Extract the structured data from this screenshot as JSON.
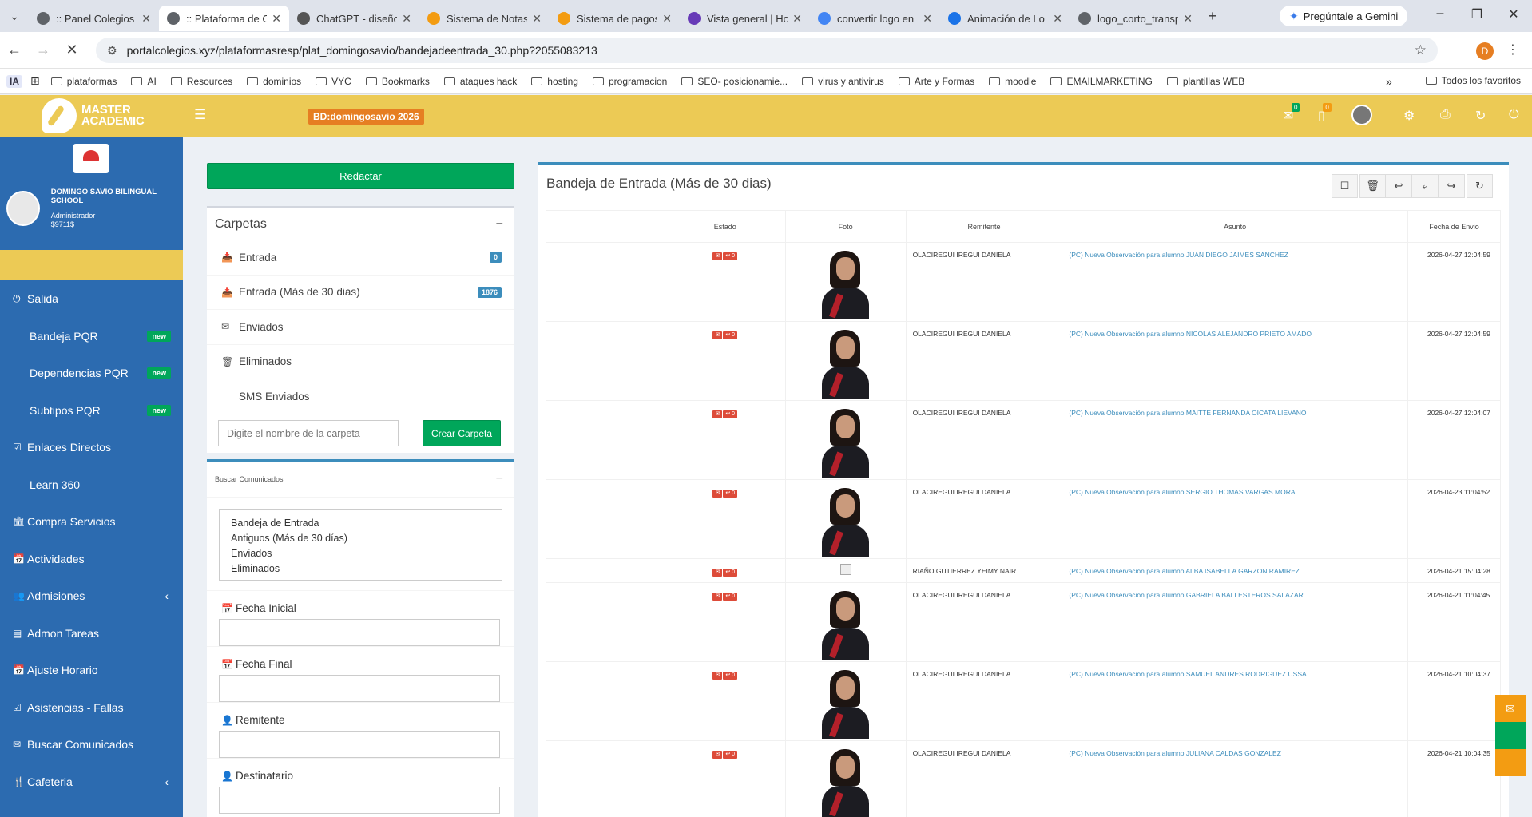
{
  "browser": {
    "tabs": [
      {
        "title": ":: Panel Colegios",
        "color": "#5f6368",
        "active": false
      },
      {
        "title": ":: Plataforma de C",
        "color": "#5f6368",
        "active": true
      },
      {
        "title": "ChatGPT - diseño",
        "color": "#555555",
        "active": false
      },
      {
        "title": "Sistema de Notas",
        "color": "#f39c12",
        "active": false
      },
      {
        "title": "Sistema de pagos",
        "color": "#f39c12",
        "active": false
      },
      {
        "title": "Vista general | Ho",
        "color": "#673ab7",
        "active": false
      },
      {
        "title": "convertir logo en",
        "color": "#4285f4",
        "active": false
      },
      {
        "title": "Animación de Lo",
        "color": "#1a73e8",
        "active": false
      },
      {
        "title": "logo_corto_transp",
        "color": "#5f6368",
        "active": false
      }
    ],
    "gemini_label": "Pregúntale a Gemini",
    "url": "portalcolegios.xyz/plataformasresp/plat_domingosavio/bandejadeentrada_30.php?2055083213",
    "profile_initial": "D",
    "bookmarks": [
      "plataformas",
      "AI",
      "Resources",
      "dominios",
      "VYC",
      "Bookmarks",
      "ataques hack",
      "hosting",
      "programacion",
      "SEO- posicionamie...",
      "virus y antivirus",
      "Arte y Formas",
      "moodle",
      "EMAILMARKETING",
      "plantillas WEB"
    ],
    "bookmarks_ia": "IA",
    "bookmarks_all": "Todos los favoritos"
  },
  "header": {
    "logo_line1": "MASTER",
    "logo_line2": "ACADEMIC",
    "db_badge": "BD:domingosavio 2026",
    "mail_count": "0",
    "doc_count": "0"
  },
  "sidebar": {
    "school_name": "DOMINGO SAVIO BILINGUAL SCHOOL",
    "role": "Administrador",
    "user_code": "$9711$",
    "items": [
      {
        "label": "Salida",
        "icon": "⏻",
        "sub": false,
        "new": false,
        "arrow": false
      },
      {
        "label": "Bandeja PQR",
        "icon": "",
        "sub": true,
        "new": true,
        "arrow": false
      },
      {
        "label": "Dependencias PQR",
        "icon": "",
        "sub": true,
        "new": true,
        "arrow": false
      },
      {
        "label": "Subtipos PQR",
        "icon": "",
        "sub": true,
        "new": true,
        "arrow": false
      },
      {
        "label": "Enlaces Directos",
        "icon": "☑",
        "sub": false,
        "new": false,
        "arrow": false
      },
      {
        "label": "Learn 360",
        "icon": "",
        "sub": true,
        "new": false,
        "arrow": false
      },
      {
        "label": "Compra Servicios",
        "icon": "🏛",
        "sub": false,
        "new": false,
        "arrow": false
      },
      {
        "label": "Actividades",
        "icon": "📅",
        "sub": false,
        "new": false,
        "arrow": false
      },
      {
        "label": "Admisiones",
        "icon": "👥",
        "sub": false,
        "new": false,
        "arrow": true
      },
      {
        "label": "Admon Tareas",
        "icon": "▤",
        "sub": false,
        "new": false,
        "arrow": false
      },
      {
        "label": "Ajuste Horario",
        "icon": "📅",
        "sub": false,
        "new": false,
        "arrow": false
      },
      {
        "label": "Asistencias - Fallas",
        "icon": "☑",
        "sub": false,
        "new": false,
        "arrow": false
      },
      {
        "label": "Buscar Comunicados",
        "icon": "✉",
        "sub": false,
        "new": false,
        "arrow": false
      },
      {
        "label": "Cafeteria",
        "icon": "🍴",
        "sub": false,
        "new": false,
        "arrow": true
      }
    ],
    "new_label": "new"
  },
  "left": {
    "compose_label": "Redactar",
    "folders_title": "Carpetas",
    "folders": [
      {
        "label": "Entrada",
        "icon": "📥",
        "count": "0"
      },
      {
        "label": "Entrada (Más de 30 dias)",
        "icon": "📥",
        "count": "1876"
      },
      {
        "label": "Enviados",
        "icon": "✉",
        "count": ""
      },
      {
        "label": "Eliminados",
        "icon": "🗑",
        "count": ""
      },
      {
        "label": "SMS Enviados",
        "icon": "",
        "count": ""
      }
    ],
    "folder_placeholder": "Digite el nombre de la carpeta",
    "create_folder_label": "Crear Carpeta",
    "search_title": "Buscar Comunicados",
    "search_options": [
      "Bandeja de Entrada",
      "Antiguos (Más de 30 días)",
      "Enviados",
      "Eliminados"
    ],
    "fields": [
      {
        "label": "Fecha Inicial",
        "icon": "📅"
      },
      {
        "label": "Fecha Final",
        "icon": "📅"
      },
      {
        "label": "Remitente",
        "icon": "👤"
      },
      {
        "label": "Destinatario",
        "icon": "👤"
      }
    ]
  },
  "inbox": {
    "title": "Bandeja de Entrada (Más de 30 dias)",
    "columns": [
      "",
      "Estado",
      "Foto",
      "Remitente",
      "Asunto",
      "Fecha de Envio"
    ],
    "rows": [
      {
        "sender": "OLACIREGUI IREGUI DANIELA",
        "subject": "(PC) Nueva Observación para alumno JUAN DIEGO JAIMES SANCHEZ",
        "date": "2026-04-27 12:04:59",
        "photo": true
      },
      {
        "sender": "OLACIREGUI IREGUI DANIELA",
        "subject": "(PC) Nueva Observación para alumno NICOLAS ALEJANDRO PRIETO AMADO",
        "date": "2026-04-27 12:04:59",
        "photo": true
      },
      {
        "sender": "OLACIREGUI IREGUI DANIELA",
        "subject": "(PC) Nueva Observación para alumno MAITTE FERNANDA OICATA LIEVANO",
        "date": "2026-04-27 12:04:07",
        "photo": true
      },
      {
        "sender": "OLACIREGUI IREGUI DANIELA",
        "subject": "(PC) Nueva Observación para alumno SERGIO THOMAS VARGAS MORA",
        "date": "2026-04-23 11:04:52",
        "photo": true
      },
      {
        "sender": "RIAÑO GUTIERREZ YEIMY NAIR",
        "subject": "(PC) Nueva Observación para alumno ALBA ISABELLA GARZON RAMIREZ",
        "date": "2026-04-21 15:04:28",
        "photo": false
      },
      {
        "sender": "OLACIREGUI IREGUI DANIELA",
        "subject": "(PC) Nueva Observación para alumno GABRIELA BALLESTEROS SALAZAR",
        "date": "2026-04-21 11:04:45",
        "photo": true
      },
      {
        "sender": "OLACIREGUI IREGUI DANIELA",
        "subject": "(PC) Nueva Observación para alumno SAMUEL ANDRES RODRIGUEZ USSA",
        "date": "2026-04-21 10:04:37",
        "photo": true
      },
      {
        "sender": "OLACIREGUI IREGUI DANIELA",
        "subject": "(PC) Nueva Observación para alumno JULIANA CALDAS GONZALEZ",
        "date": "2026-04-21 10:04:35",
        "photo": true
      }
    ]
  },
  "colors": {
    "header": "#ecca55",
    "sidebar": "#2c6bb0",
    "green": "#00a65a",
    "primary": "#3c8dbc",
    "danger": "#dd4b39",
    "orange": "#f39c12"
  }
}
